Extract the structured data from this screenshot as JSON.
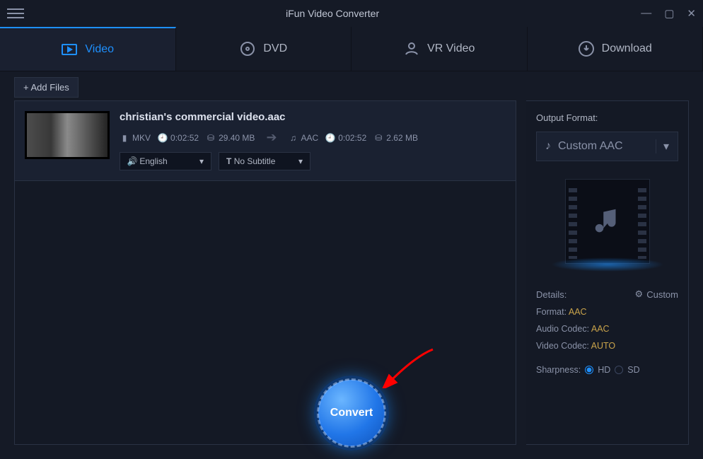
{
  "titlebar": {
    "title": "iFun Video Converter"
  },
  "tabs": [
    {
      "label": "Video",
      "icon": "play-icon",
      "active": true
    },
    {
      "label": "DVD",
      "icon": "disc-icon",
      "active": false
    },
    {
      "label": "VR Video",
      "icon": "vr-icon",
      "active": false
    },
    {
      "label": "Download",
      "icon": "download-icon",
      "active": false
    }
  ],
  "toolbar": {
    "add_files_label": "Add Files"
  },
  "file": {
    "name": "christian's commercial video.aac",
    "source": {
      "format": "MKV",
      "duration": "0:02:52",
      "size": "29.40 MB"
    },
    "target": {
      "format": "AAC",
      "duration": "0:02:52",
      "size": "2.62 MB"
    },
    "audio_track": "English",
    "subtitle": "No Subtitle"
  },
  "output": {
    "label": "Output Format:",
    "selected": "Custom AAC",
    "details_label": "Details:",
    "custom_label": "Custom",
    "format_key": "Format:",
    "format_val": "AAC",
    "audio_codec_key": "Audio Codec:",
    "audio_codec_val": "AAC",
    "video_codec_key": "Video Codec:",
    "video_codec_val": "AUTO",
    "sharpness_label": "Sharpness:",
    "sharpness_hd": "HD",
    "sharpness_sd": "SD"
  },
  "convert": {
    "label": "Convert"
  }
}
